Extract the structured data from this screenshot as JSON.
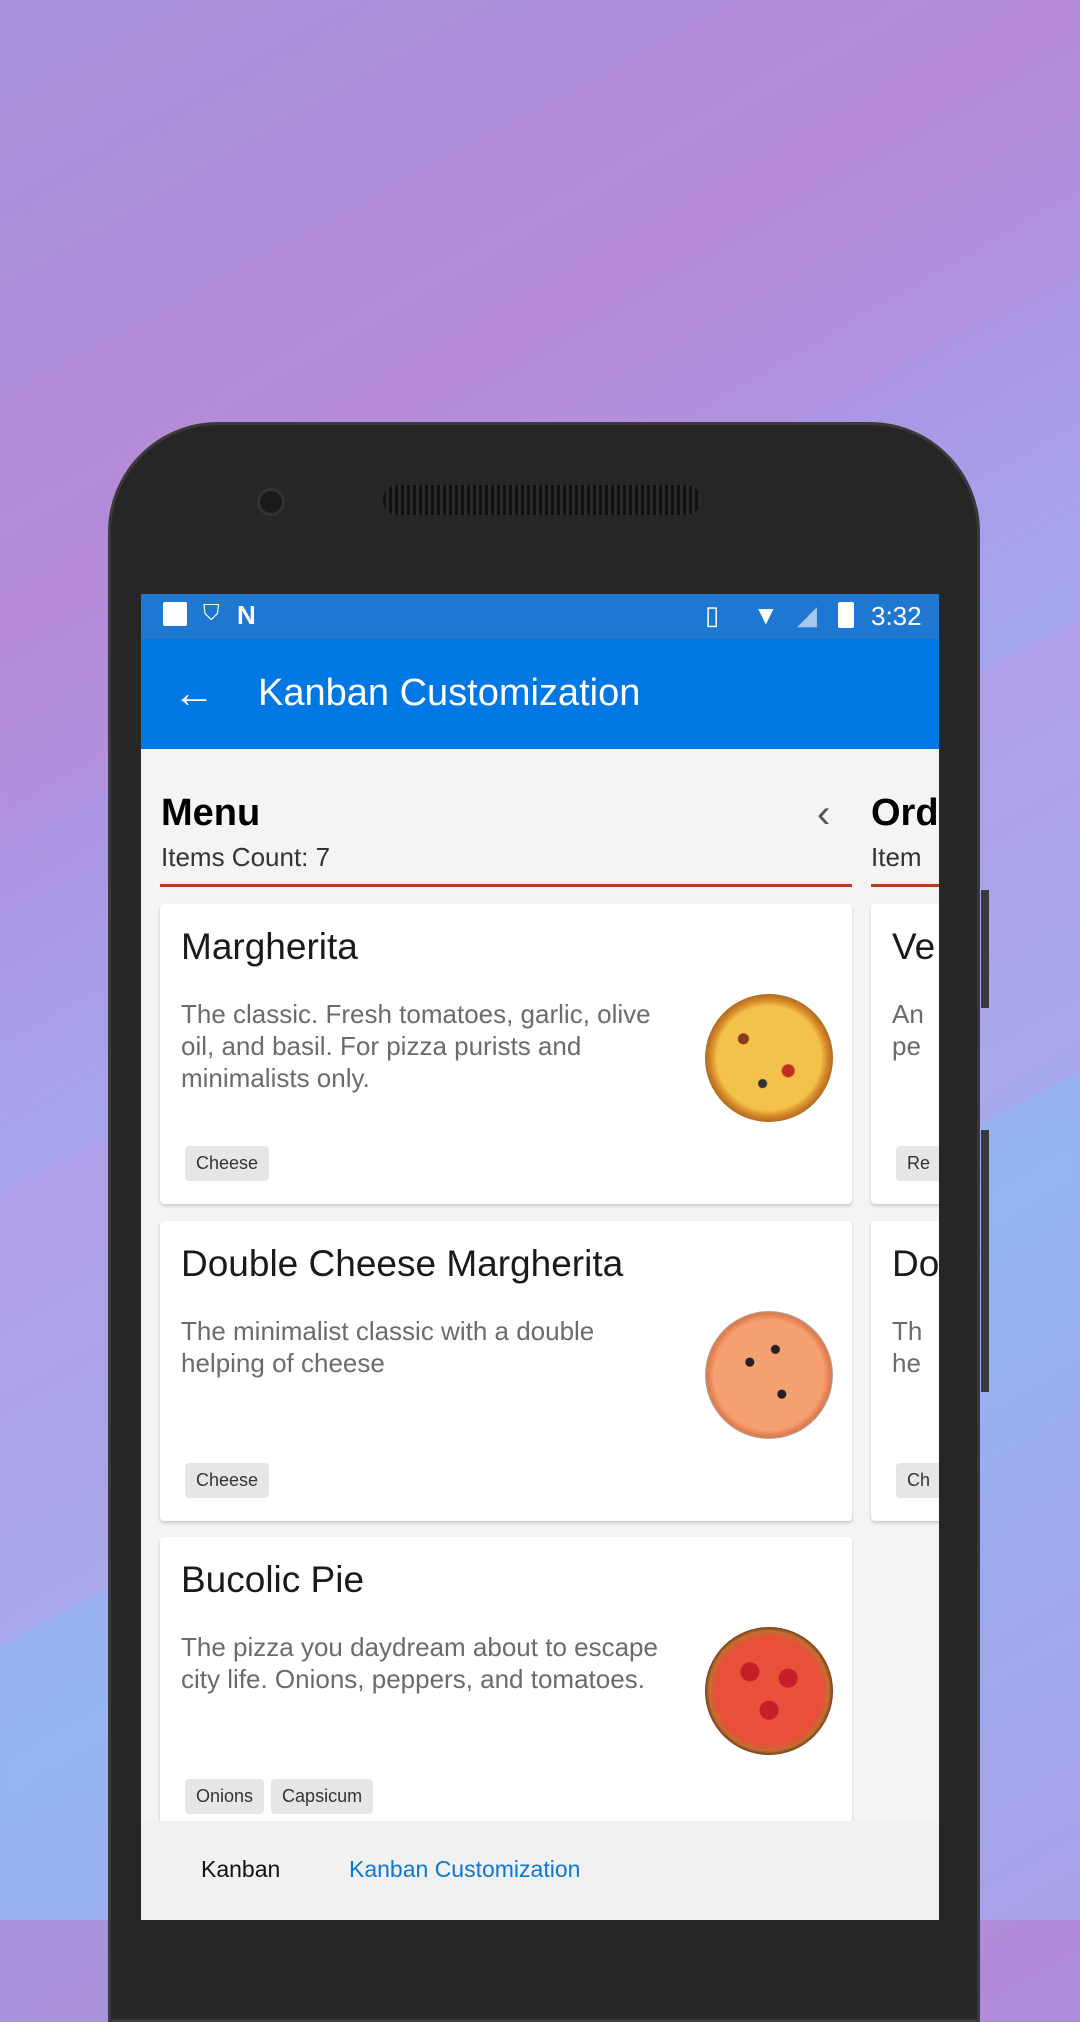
{
  "status_bar": {
    "time": "3:32"
  },
  "app_bar": {
    "title": "Kanban Customization"
  },
  "columns": [
    {
      "title": "Menu",
      "count_label": "Items Count: 7",
      "cards": [
        {
          "title": "Margherita",
          "description": "The classic. Fresh tomatoes, garlic, olive oil, and basil. For pizza purists and minimalists only.",
          "tags": [
            "Cheese"
          ]
        },
        {
          "title": "Double Cheese Margherita",
          "description": "The minimalist classic with a double helping of cheese",
          "tags": [
            "Cheese"
          ]
        },
        {
          "title": "Bucolic Pie",
          "description": "The pizza you daydream about to escape city life. Onions, peppers, and tomatoes.",
          "tags": [
            "Onions",
            "Capsicum"
          ]
        }
      ]
    },
    {
      "title": "Ord",
      "count_label": "Item",
      "cards": [
        {
          "title": "Ve",
          "description": "An pe",
          "tags": [
            "Re"
          ]
        },
        {
          "title": "Do",
          "description": "Th he",
          "tags": [
            "Ch"
          ]
        }
      ]
    }
  ],
  "bottom_tabs": [
    {
      "label": "Kanban",
      "active": false
    },
    {
      "label": "Kanban Customization",
      "active": true
    }
  ],
  "colors": {
    "app_bar": "#0078e3",
    "status_bar": "#1e78d2",
    "column_underline": "#b5401e",
    "active_tab": "#0a78d4"
  }
}
